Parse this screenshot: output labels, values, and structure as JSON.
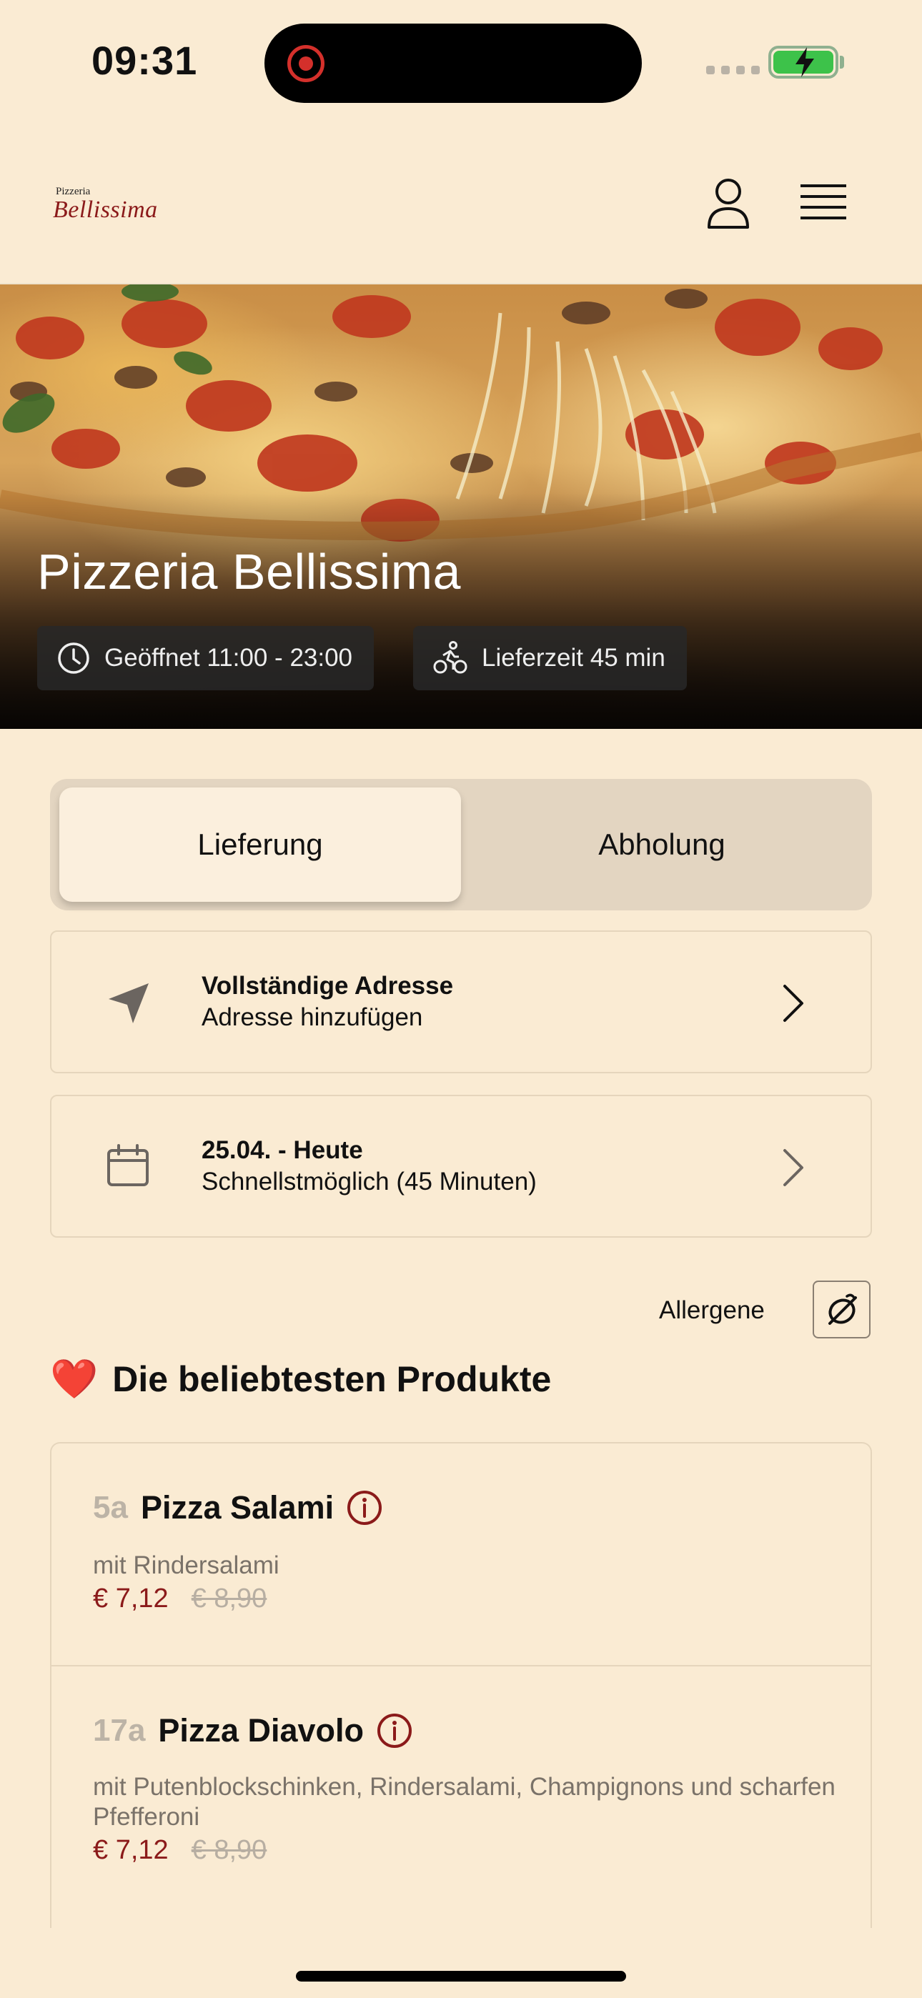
{
  "status_bar": {
    "time": "09:31"
  },
  "header": {
    "logo_small": "Pizzeria",
    "logo_main": "Bellissima"
  },
  "hero": {
    "title": "Pizzeria Bellissima",
    "opening_hours": "Geöffnet 11:00 - 23:00",
    "delivery_time": "Lieferzeit 45 min"
  },
  "order_mode": {
    "options": [
      "Lieferung",
      "Abholung"
    ],
    "selected": "Lieferung"
  },
  "address_card": {
    "title": "Vollständige Adresse",
    "subtitle": "Adresse hinzufügen",
    "icon": "location-arrow-icon"
  },
  "date_card": {
    "title": "25.04. - Heute",
    "subtitle": "Schnellstmöglich (45 Minuten)",
    "icon": "calendar-icon"
  },
  "allergens": {
    "label": "Allergene",
    "icon": "allergen-icon"
  },
  "popular": {
    "emoji": "❤️",
    "title": "Die beliebtesten Produkte",
    "products": [
      {
        "number": "5a",
        "name": "Pizza Salami",
        "description": "mit Rindersalami",
        "price": "€ 7,12",
        "old_price": "€ 8,90"
      },
      {
        "number": "17a",
        "name": "Pizza Diavolo",
        "description": "mit Putenblockschinken, Rindersalami, Champignons und scharfen Pfefferoni",
        "price": "€ 7,12",
        "old_price": "€ 8,90"
      }
    ]
  },
  "colors": {
    "background": "#FAEBD3",
    "accent": "#8B1A1A",
    "toggle_track": "#E3D5C1",
    "muted_text": "#7A7269"
  }
}
